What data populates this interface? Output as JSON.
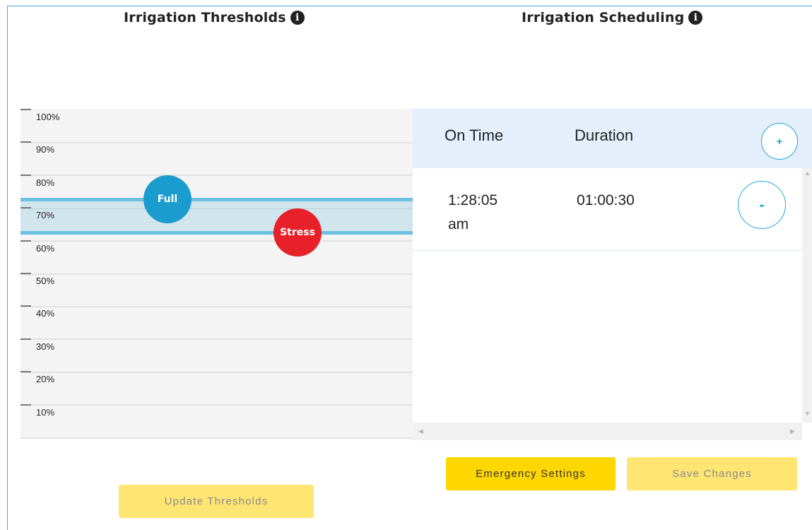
{
  "thresholds": {
    "title": "Irrigation Thresholds",
    "info_icon": "info-circle-icon",
    "y_axis_labels": [
      "100%",
      "90%",
      "80%",
      "70%",
      "60%",
      "50%",
      "40%",
      "30%",
      "20%",
      "10%"
    ],
    "full_handle": {
      "label": "Full",
      "value_percent": 76,
      "color": "#1a9ccf"
    },
    "stress_handle": {
      "label": "Stress",
      "value_percent": 66,
      "color": "#e8202a"
    },
    "update_button": "Update Thresholds"
  },
  "scheduling": {
    "title": "Irrigation Scheduling",
    "info_icon": "info-circle-icon",
    "columns": {
      "on_time": "On Time",
      "duration": "Duration"
    },
    "add_button": "+",
    "rows": [
      {
        "on_time_line1": "1:28:05",
        "on_time_line2": "am",
        "duration": "01:00:30",
        "remove_button": "-"
      }
    ],
    "emergency_button": "Emergency Settings",
    "save_button": "Save Changes"
  },
  "colors": {
    "accent_blue": "#1fa6d9",
    "button_yellow": "#ffd700",
    "button_yellow_disabled": "#ffe673",
    "header_bg": "#e4effb"
  }
}
